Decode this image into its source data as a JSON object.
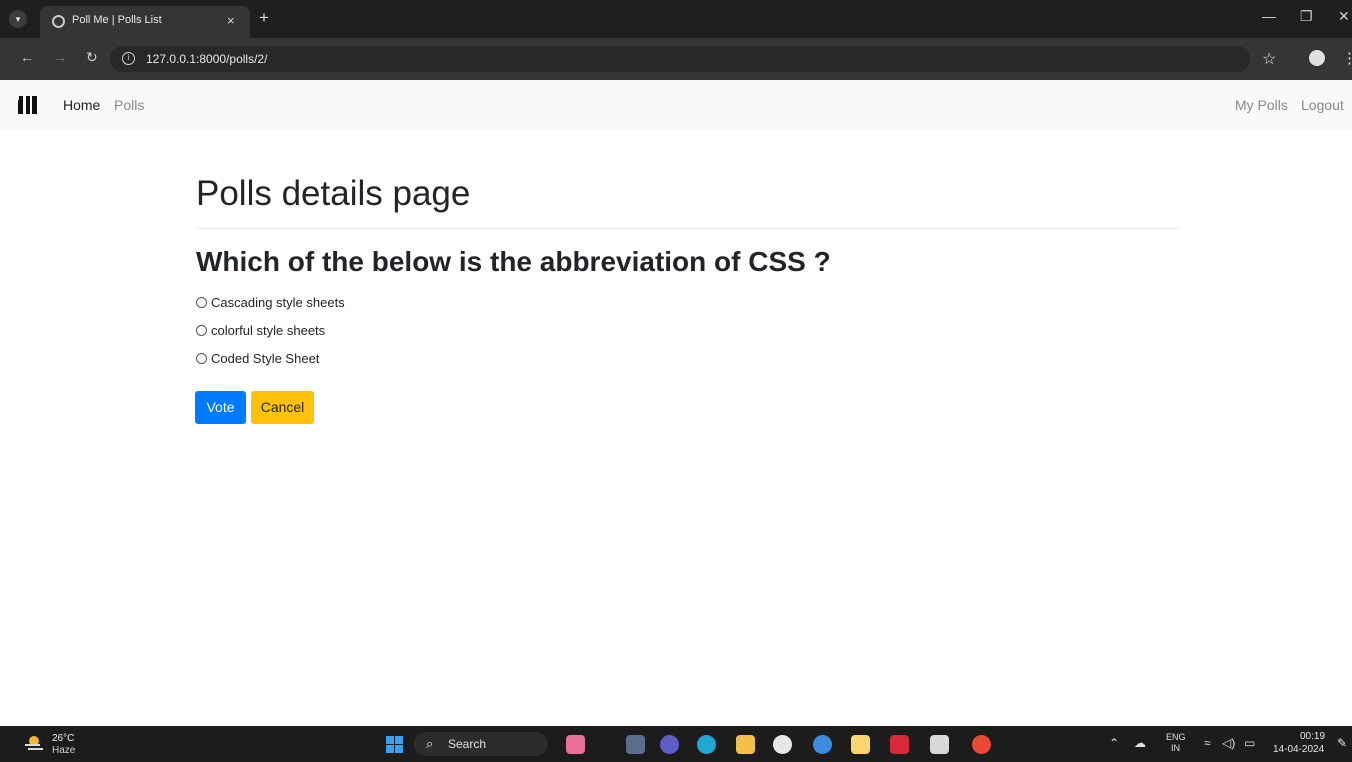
{
  "browser": {
    "tab_title": "Poll Me | Polls List",
    "tab_close": "×",
    "new_tab": "+",
    "url": "127.0.0.1:8000/polls/2/"
  },
  "navbar": {
    "links": {
      "home": "Home",
      "polls": "Polls",
      "my_polls": "My Polls",
      "logout": "Logout"
    }
  },
  "main": {
    "page_title": "Polls details page",
    "question": "Which of the below is the abbreviation of CSS ?",
    "choices": [
      "Cascading style sheets",
      "colorful style sheets",
      "Coded Style Sheet"
    ],
    "buttons": {
      "vote": "Vote",
      "cancel": "Cancel"
    }
  },
  "taskbar": {
    "weather_temp": "26°C",
    "weather_condition": "Haze",
    "search_label": "Search",
    "lang_top": "ENG",
    "lang_bottom": "IN",
    "time": "00:19",
    "date": "14-04-2024"
  },
  "colors": {
    "vote_button": "#007bff",
    "cancel_button": "#ffc107",
    "navbar_bg": "#f8f9fa"
  }
}
